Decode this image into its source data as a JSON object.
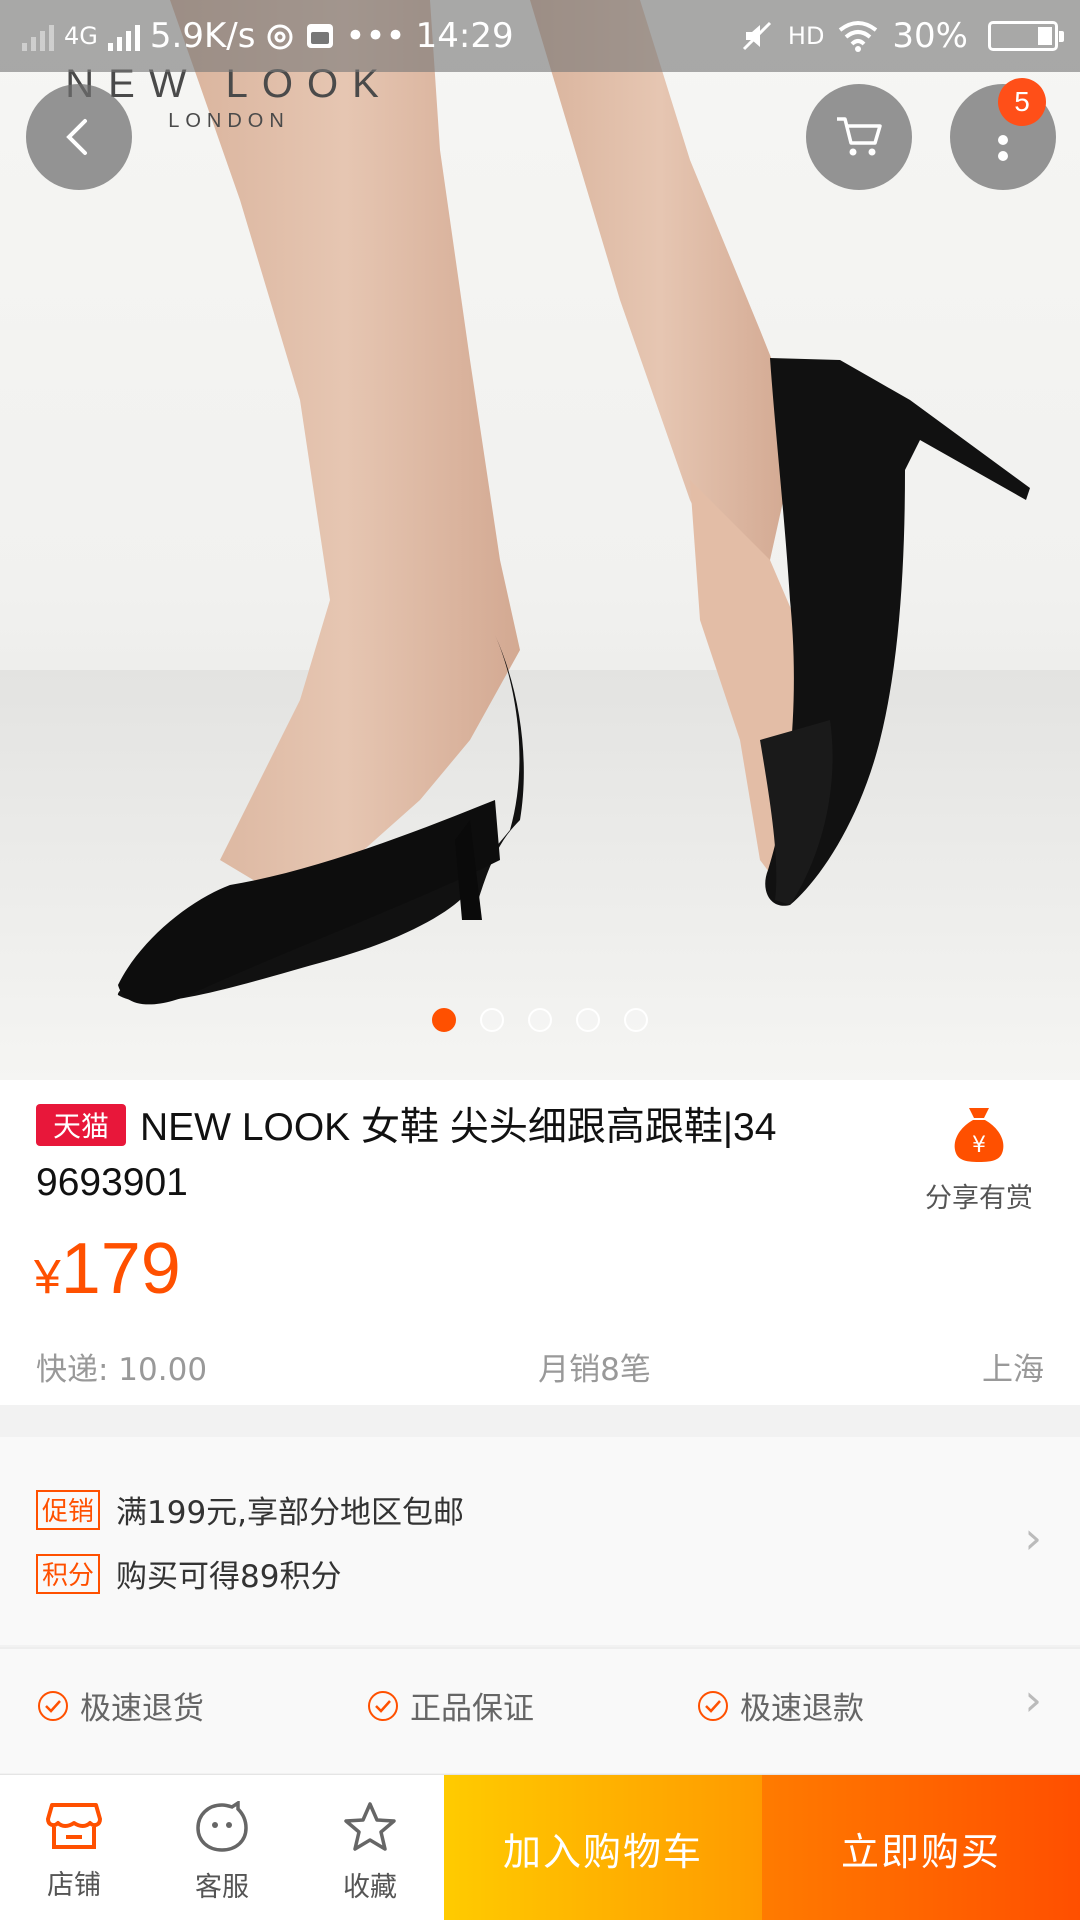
{
  "status_bar": {
    "network": "4G",
    "speed": "5.9K/s",
    "time": "14:29",
    "more": "•••",
    "hd": "HD",
    "battery": "30%"
  },
  "hero": {
    "logo_line1": "NEW LOOK",
    "logo_line2": "LONDON",
    "cart_badge": "5",
    "slide_count": 5,
    "active_slide": 1
  },
  "product": {
    "store_tag": "天猫",
    "title": "NEW LOOK 女鞋 尖头细跟高跟鞋|349693901",
    "share_label": "分享有赏",
    "currency": "¥",
    "price": "179",
    "shipping": "快递: 10.00",
    "monthly_sales": "月销8笔",
    "location": "上海"
  },
  "promotions": [
    {
      "tag": "促销",
      "text": "满199元,享部分地区包邮"
    },
    {
      "tag": "积分",
      "text": "购买可得89积分"
    }
  ],
  "guarantees": [
    "极速退货",
    "正品保证",
    "极速退款"
  ],
  "bottom_bar": {
    "store": "店铺",
    "service": "客服",
    "favorite": "收藏",
    "add_to_cart": "加入购物车",
    "buy_now": "立即购买"
  },
  "colors": {
    "accent": "#ff5000",
    "tmall_red": "#e8173a",
    "cart_gradient_start": "#ffcb00",
    "buy_gradient_end": "#ff4f00"
  }
}
